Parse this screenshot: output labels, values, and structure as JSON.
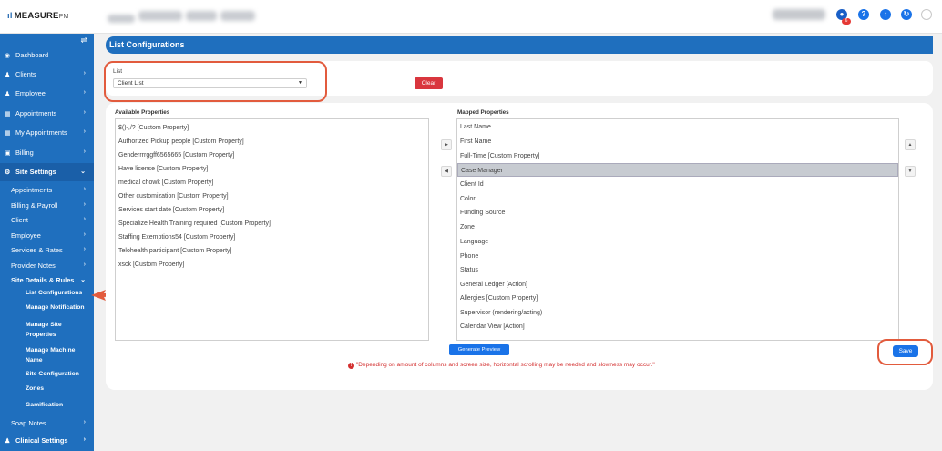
{
  "topbar": {
    "logo_text": "MEASURE",
    "logo_suffix": "PM",
    "notification_count": "6",
    "icons": [
      "user-icon",
      "help-icon",
      "upload-icon",
      "refresh-icon",
      "profile-icon"
    ]
  },
  "sidebar": {
    "items": [
      {
        "label": "Dashboard",
        "icon": "dashboard-icon"
      },
      {
        "label": "Clients",
        "icon": "user-icon"
      },
      {
        "label": "Employee",
        "icon": "users-icon"
      },
      {
        "label": "Appointments",
        "icon": "calendar-icon"
      },
      {
        "label": "My Appointments",
        "icon": "calendar-icon"
      },
      {
        "label": "Billing",
        "icon": "money-icon"
      },
      {
        "label": "Site Settings",
        "icon": "gear-icon"
      }
    ],
    "site_settings_sub": [
      "Appointments",
      "Billing & Payroll",
      "Client",
      "Employee",
      "Services & Rates",
      "Provider Notes",
      "Site Details & Rules"
    ],
    "site_details_sub": [
      "List Configurations",
      "Manage Notification",
      "Manage Site Properties",
      "Manage Machine Name",
      "Site Configuration",
      "Zones",
      "Gamification"
    ],
    "bottom_items": [
      {
        "label": "Soap Notes"
      },
      {
        "label": "Clinical Settings",
        "icon": "user-icon"
      }
    ]
  },
  "page": {
    "title": "List Configurations",
    "list_label": "List",
    "list_value": "Client List",
    "clear_label": "Clear",
    "available_title": "Available Properties",
    "mapped_title": "Mapped Properties",
    "available_properties": [
      "$()-,/?  [Custom Property]",
      "Authorized Pickup people [Custom Property]",
      "Genderrrrggff6565665 [Custom Property]",
      "Have license [Custom Property]",
      "medical chowk [Custom Property]",
      "Other customization [Custom Property]",
      "Services start date [Custom Property]",
      "Specialize Health Training required [Custom Property]",
      "Staffing Exemptions54 [Custom Property]",
      "Telohealth participant [Custom Property]",
      "xsck [Custom Property]"
    ],
    "mapped_properties": [
      "Last Name",
      "First Name",
      "Full-Time [Custom Property]",
      "Case Manager",
      "Client Id",
      "Color",
      "Funding Source",
      "Zone",
      "Language",
      "Phone",
      "Status",
      "General Ledger [Action]",
      "Allergies [Custom Property]",
      "Supervisor (rendering/acting)",
      "Calendar View [Action]"
    ],
    "selected_mapped": "Case Manager",
    "generate_preview_label": "Generate Preview",
    "save_label": "Save",
    "warning_text": "\"Depending on amount of columns and screen size, horizontal scrolling may be needed and slowness may occur.\""
  }
}
